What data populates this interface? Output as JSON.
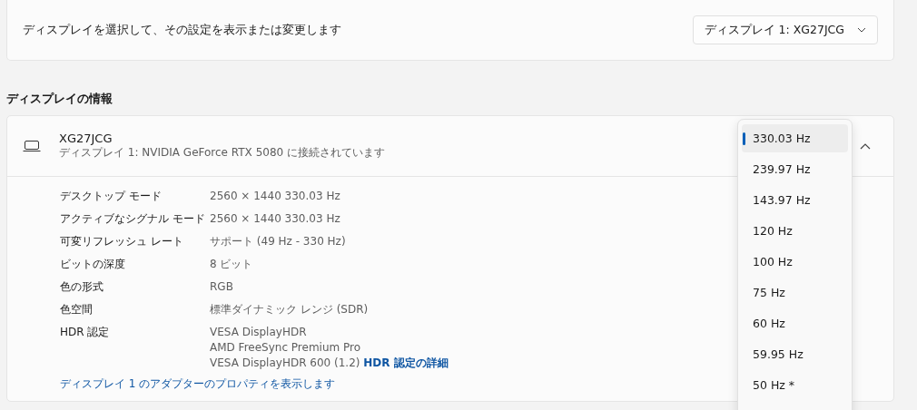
{
  "select_display": {
    "label": "ディスプレイを選択して、その設定を表示または変更します",
    "value": "ディスプレイ 1: XG27JCG"
  },
  "section_title": "ディスプレイの情報",
  "display": {
    "name": "XG27JCG",
    "subtitle": "ディスプレイ 1: NVIDIA GeForce RTX 5080 に接続されています",
    "expanded": true,
    "details": [
      {
        "label": "デスクトップ モード",
        "lines": [
          "2560 × 1440 330.03 Hz"
        ]
      },
      {
        "label": "アクティブなシグナル モード",
        "lines": [
          "2560 × 1440 330.03 Hz"
        ]
      },
      {
        "label": "可変リフレッシュ レート",
        "lines": [
          "サポート (49 Hz - 330 Hz)"
        ]
      },
      {
        "label": "ビットの深度",
        "lines": [
          "8 ビット"
        ]
      },
      {
        "label": "色の形式",
        "lines": [
          "RGB"
        ]
      },
      {
        "label": "色空間",
        "lines": [
          "標準ダイナミック レンジ (SDR)"
        ]
      },
      {
        "label": "HDR 認定",
        "lines": [
          "VESA DisplayHDR",
          "AMD FreeSync Premium Pro",
          "VESA DisplayHDR 600 (1.2)"
        ],
        "link": "HDR 認定の詳細"
      }
    ],
    "adapter_link": "ディスプレイ 1 のアダプターのプロパティを表示します"
  },
  "refresh_menu": [
    {
      "label": "330.03 Hz",
      "selected": true
    },
    {
      "label": "239.97 Hz",
      "selected": false
    },
    {
      "label": "143.97 Hz",
      "selected": false
    },
    {
      "label": "120 Hz",
      "selected": false
    },
    {
      "label": "100 Hz",
      "selected": false
    },
    {
      "label": "75 Hz",
      "selected": false
    },
    {
      "label": "60 Hz",
      "selected": false
    },
    {
      "label": "59.95 Hz",
      "selected": false
    },
    {
      "label": "50 Hz *",
      "selected": false
    }
  ]
}
